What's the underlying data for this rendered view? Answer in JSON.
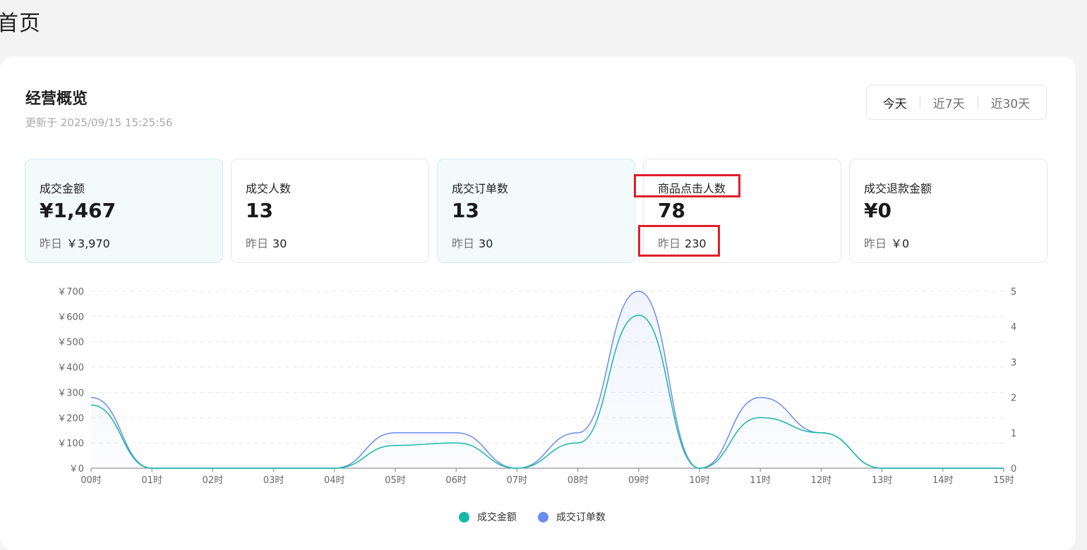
{
  "page": {
    "title": "首页"
  },
  "overview": {
    "title": "经营概览",
    "updated": "更新于 2025/09/15 15:25:56",
    "ranges": [
      "今天",
      "近7天",
      "近30天"
    ],
    "active_range": "今天"
  },
  "cards": [
    {
      "label": "成交金额",
      "value": "¥1,467",
      "compare_prefix": "昨日",
      "compare_value": "￥3,970",
      "highlight": true
    },
    {
      "label": "成交人数",
      "value": "13",
      "compare_prefix": "昨日",
      "compare_value": "30",
      "highlight": false
    },
    {
      "label": "成交订单数",
      "value": "13",
      "compare_prefix": "昨日",
      "compare_value": "30",
      "highlight": true
    },
    {
      "label": "商品点击人数",
      "value": "78",
      "compare_prefix": "昨日",
      "compare_value": "230",
      "highlight": false
    },
    {
      "label": "成交退款金额",
      "value": "¥0",
      "compare_prefix": "昨日",
      "compare_value": "￥0",
      "highlight": false
    }
  ],
  "chart_data": {
    "type": "line",
    "x": [
      "00时",
      "01时",
      "02时",
      "03时",
      "04时",
      "05时",
      "06时",
      "07时",
      "08时",
      "09时",
      "10时",
      "11时",
      "12时",
      "13时",
      "14时",
      "15时"
    ],
    "y_left_ticks": [
      "￥0",
      "￥100",
      "￥200",
      "￥300",
      "￥400",
      "￥500",
      "￥600",
      "￥700"
    ],
    "y_right_ticks": [
      "0",
      "1",
      "2",
      "3",
      "4",
      "5"
    ],
    "y_left_lim": [
      0,
      700
    ],
    "y_right_lim": [
      0,
      5
    ],
    "grid": true,
    "legend_position": "bottom",
    "series": [
      {
        "name": "成交金额",
        "axis": "left",
        "color": "#14b8a6",
        "values": [
          250,
          0,
          0,
          0,
          0,
          90,
          100,
          0,
          100,
          605,
          0,
          200,
          140,
          0,
          0,
          0
        ]
      },
      {
        "name": "成交订单数",
        "axis": "right",
        "color": "#6b8cef",
        "values": [
          2,
          0,
          0,
          0,
          0,
          1,
          1,
          0,
          1,
          5,
          0,
          2,
          1,
          0,
          0,
          0
        ]
      }
    ]
  }
}
